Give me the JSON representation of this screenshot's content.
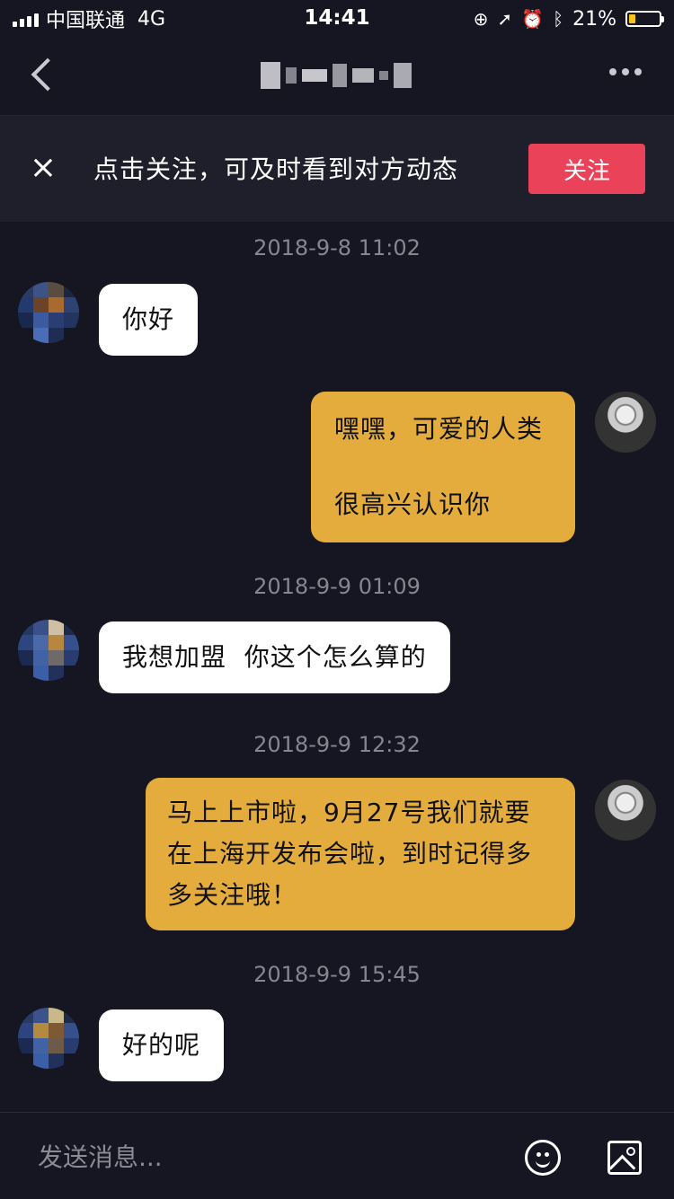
{
  "status_bar": {
    "carrier": "中国联通",
    "network": "4G",
    "time": "14:41",
    "battery_percent": "21%",
    "battery_level": 0.21,
    "icons": [
      "signal-icon",
      "orientation-lock-icon",
      "location-icon",
      "alarm-icon",
      "bluetooth-icon",
      "battery-icon"
    ]
  },
  "nav": {
    "back_icon": "chevron-left-icon",
    "more_icon": "more-dots-icon"
  },
  "banner": {
    "close_icon": "close-icon",
    "text": "点击关注，可及时看到对方动态",
    "follow_label": "关注",
    "follow_color": "#ea4359"
  },
  "chat": {
    "timestamps": [
      "2018-9-8 11:02",
      "2018-9-9 01:09",
      "2018-9-9 12:32",
      "2018-9-9 15:45"
    ],
    "messages": [
      {
        "side": "in",
        "lines": [
          "你好"
        ]
      },
      {
        "side": "out",
        "lines": [
          "嘿嘿，可爱的人类",
          "",
          "很高兴认识你"
        ]
      },
      {
        "side": "in",
        "lines": [
          "我想加盟  你这个怎么算的"
        ]
      },
      {
        "side": "out",
        "lines": [
          "马上上市啦，9月27号我们就要",
          "在上海开发布会啦，到时记得多",
          "多关注哦！"
        ]
      },
      {
        "side": "in",
        "lines": [
          "好的呢"
        ]
      }
    ],
    "colors": {
      "incoming_bubble": "#ffffff",
      "outgoing_bubble": "#e3ac3d",
      "background": "#161622"
    }
  },
  "input_bar": {
    "placeholder": "发送消息...",
    "emoji_icon": "emoji-icon",
    "image_icon": "image-icon"
  }
}
